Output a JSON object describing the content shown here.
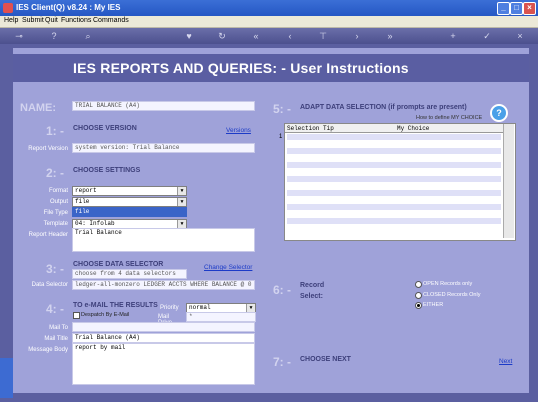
{
  "window": {
    "title": "IES Client(Q) v8.24 : My IES",
    "min": "_",
    "max": "□",
    "close": "×"
  },
  "menu": [
    "Help",
    "Submit",
    "Quit",
    "Functions",
    "Commands"
  ],
  "toolbar_icons": [
    "key-icon",
    "help-icon",
    "search-icon",
    "heart-icon",
    "refresh-icon",
    "first-icon",
    "back-icon",
    "forward-icon",
    "bookmark-icon",
    "last-icon",
    "add-icon",
    "check-icon",
    "close-icon"
  ],
  "banner": {
    "title": "IES REPORTS AND QUERIES: -   User Instructions"
  },
  "name": {
    "label": "NAME:",
    "value": "TRIAL BALANCE (A4)"
  },
  "section1": {
    "num": "1: -",
    "title": "CHOOSE VERSION",
    "link": "Versions",
    "report_version_label": "Report Version",
    "report_version_value": "system version: Trial Balance"
  },
  "section2": {
    "num": "2: -",
    "title": "CHOOSE SETTINGS",
    "format_label": "Format",
    "format_value": "report",
    "output_label": "Output",
    "output_value": "file",
    "dropdown_option": "file",
    "filetype_label": "File Type",
    "template_label": "Template",
    "template_value": "04: Infolab",
    "header_label": "Report Header",
    "header_value": "Trial Balance"
  },
  "section3": {
    "num": "3: -",
    "title": "CHOOSE DATA SELECTOR",
    "link": "Change Selector",
    "choose_value": "choose from 4 data selectors",
    "selector_label": "Data Selector",
    "selector_value": "ledger-all-monzero LEDGER ACCTS WHERE BALANCE @ 0"
  },
  "section4": {
    "num": "4: -",
    "title": "TO e-MAIL THE RESULTS",
    "priority_label": "Priority",
    "priority_value": "normal",
    "despatch_label": "Despatch By E-Mail",
    "mail_drive_label": "Mail Drive",
    "mail_drive_value": "*",
    "mail_to_label": "Mail To",
    "mail_title_label": "Mail Title",
    "mail_title_value": "Trial Balance (A4)",
    "body_label": "Message Body",
    "body_value": "report by mail"
  },
  "section5": {
    "num": "5: -",
    "title": "ADAPT DATA SELECTION (if prompts are present)",
    "hint": "How to define MY CHOICE",
    "col1": "Selection Tip",
    "col2": "My Choice",
    "row1": "1"
  },
  "section6": {
    "num": "6: -",
    "label": "Record\nSelect:",
    "record_label": "Record",
    "select_label": "Select:",
    "opt_open": "OPEN Records only",
    "opt_closed": "CLOSED Records Only",
    "opt_either": "EITHER",
    "selected": "EITHER"
  },
  "section7": {
    "num": "7: -",
    "title": "CHOOSE NEXT",
    "link": "Next"
  },
  "help_glyph": "?",
  "colors": {
    "titlebar": "#2557c4",
    "panel": "#9fa2d9",
    "banner": "#5a5ea2",
    "link": "#1c3bc7"
  }
}
